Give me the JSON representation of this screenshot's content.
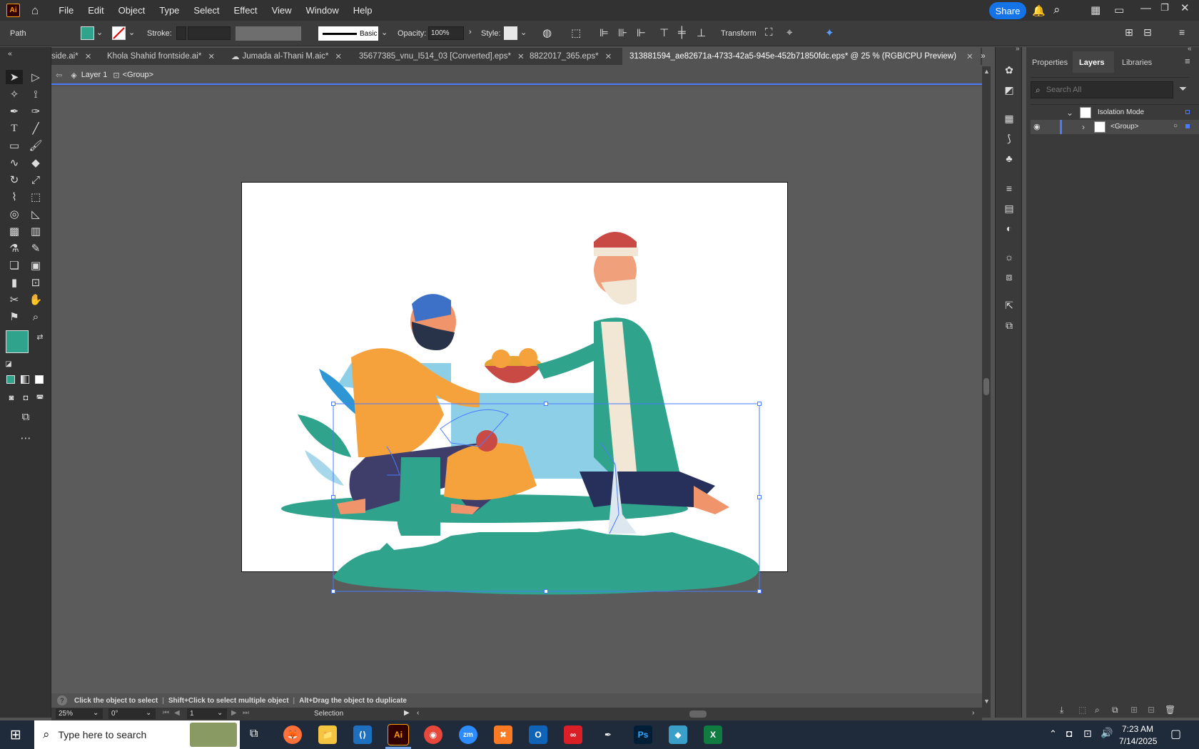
{
  "app": {
    "logo": "Ai",
    "menu": [
      "File",
      "Edit",
      "Object",
      "Type",
      "Select",
      "Effect",
      "View",
      "Window",
      "Help"
    ],
    "share_label": "Share"
  },
  "control": {
    "selection_type": "Path",
    "stroke_label": "Stroke:",
    "brush_label": "Basic",
    "opacity_label": "Opacity:",
    "opacity_value": "100%",
    "style_label": "Style:",
    "transform_label": "Transform",
    "fill_color": "#2fa38b"
  },
  "tabs": [
    {
      "label": "side.ai*",
      "active": false
    },
    {
      "label": "Khola Shahid frontside.ai*",
      "active": false
    },
    {
      "label": "Jumada al-Thani M.aic*",
      "active": false
    },
    {
      "label": "35677385_vnu_I514_03 [Converted].eps*",
      "active": false
    },
    {
      "label": "8822017_365.eps*",
      "active": false
    },
    {
      "label": "313881594_ae82671a-4733-42a5-945e-452b71850fdc.eps* @ 25 % (RGB/CPU Preview)",
      "active": true
    }
  ],
  "breadcrumb": {
    "layer": "Layer 1",
    "group": "<Group>"
  },
  "panel": {
    "tabs": [
      "Properties",
      "Layers",
      "Libraries"
    ],
    "active_tab": "Layers",
    "search_placeholder": "Search All",
    "rows": [
      {
        "label": "Isolation Mode"
      },
      {
        "label": "<Group>"
      }
    ]
  },
  "status": {
    "hint": "Click the object to select",
    "hint2": "Shift+Click to select multiple object",
    "hint3": "Alt+Drag the object to duplicate",
    "zoom": "25%",
    "rotation": "0°",
    "artboard_num": "1",
    "tool": "Selection"
  },
  "taskbar": {
    "search_placeholder": "Type here to search",
    "time": "7:23 AM",
    "date": "7/14/2025",
    "apps": [
      "Firefox",
      "Files",
      "VS Code",
      "Ai",
      "Chrome",
      "zm",
      "XAMPP",
      "Outlook",
      "Cloud",
      "Pen",
      "Ps",
      "Gem",
      "Excel"
    ]
  }
}
